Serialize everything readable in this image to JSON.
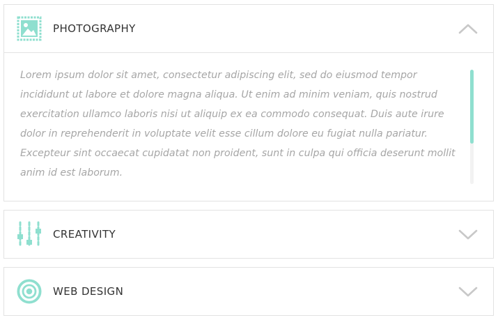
{
  "accent_color": "#8fdfcf",
  "panels": [
    {
      "title": "PHOTOGRAPHY",
      "icon": "image-stamp-icon",
      "expanded": true,
      "chevron": "chevron-up-icon",
      "body": "Lorem ipsum dolor sit amet, consectetur adipiscing elit, sed do eiusmod tempor incididunt ut labore et dolore magna aliqua. Ut enim ad minim veniam, quis nostrud exercitation ullamco laboris nisi ut aliquip ex ea commodo consequat. Duis aute irure dolor in reprehenderit in voluptate velit esse cillum dolore eu fugiat nulla pariatur. Excepteur sint occaecat cupidatat non proident, sunt in culpa qui officia deserunt mollit anim id est laborum."
    },
    {
      "title": "CREATIVITY",
      "icon": "sliders-icon",
      "expanded": false,
      "chevron": "chevron-down-icon"
    },
    {
      "title": "WEB DESIGN",
      "icon": "target-icon",
      "expanded": false,
      "chevron": "chevron-down-icon"
    }
  ]
}
